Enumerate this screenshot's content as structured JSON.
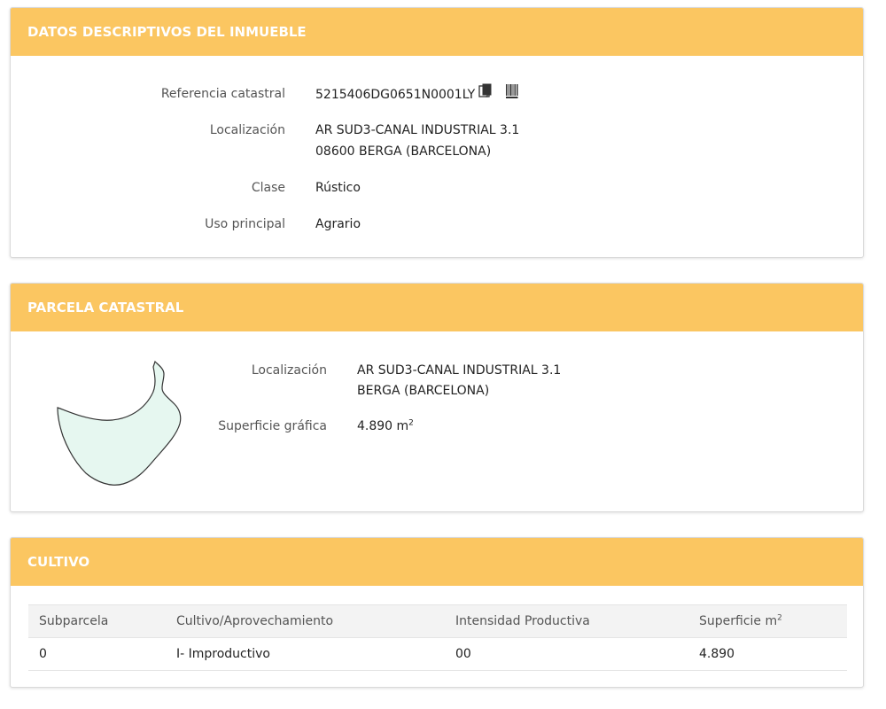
{
  "datos": {
    "title": "DATOS DESCRIPTIVOS DEL INMUEBLE",
    "referencia_label": "Referencia catastral",
    "referencia_value": "5215406DG0651N0001LY",
    "copy_icon": "copy-icon",
    "barcode_icon": "barcode-icon",
    "localizacion_label": "Localización",
    "localizacion_line1": "AR SUD3-CANAL INDUSTRIAL 3.1",
    "localizacion_line2": "08600 BERGA (BARCELONA)",
    "clase_label": "Clase",
    "clase_value": "Rústico",
    "uso_label": "Uso principal",
    "uso_value": "Agrario"
  },
  "parcela": {
    "title": "PARCELA CATASTRAL",
    "localizacion_label": "Localización",
    "localizacion_line1": "AR SUD3-CANAL INDUSTRIAL 3.1",
    "localizacion_line2": "BERGA (BARCELONA)",
    "superficie_label": "Superficie gráfica",
    "superficie_value": "4.890 m",
    "superficie_sup": "2",
    "shape_fill": "#e6f7f0",
    "shape_stroke": "#333333"
  },
  "cultivo": {
    "title": "CULTIVO",
    "headers": [
      "Subparcela",
      "Cultivo/Aprovechamiento",
      "Intensidad Productiva",
      "Superficie m"
    ],
    "header_sup": "2",
    "rows": [
      [
        "0",
        "I- Improductivo",
        "00",
        "4.890"
      ]
    ]
  },
  "colors": {
    "header_bg": "#fbc661",
    "header_text": "#ffffff"
  }
}
